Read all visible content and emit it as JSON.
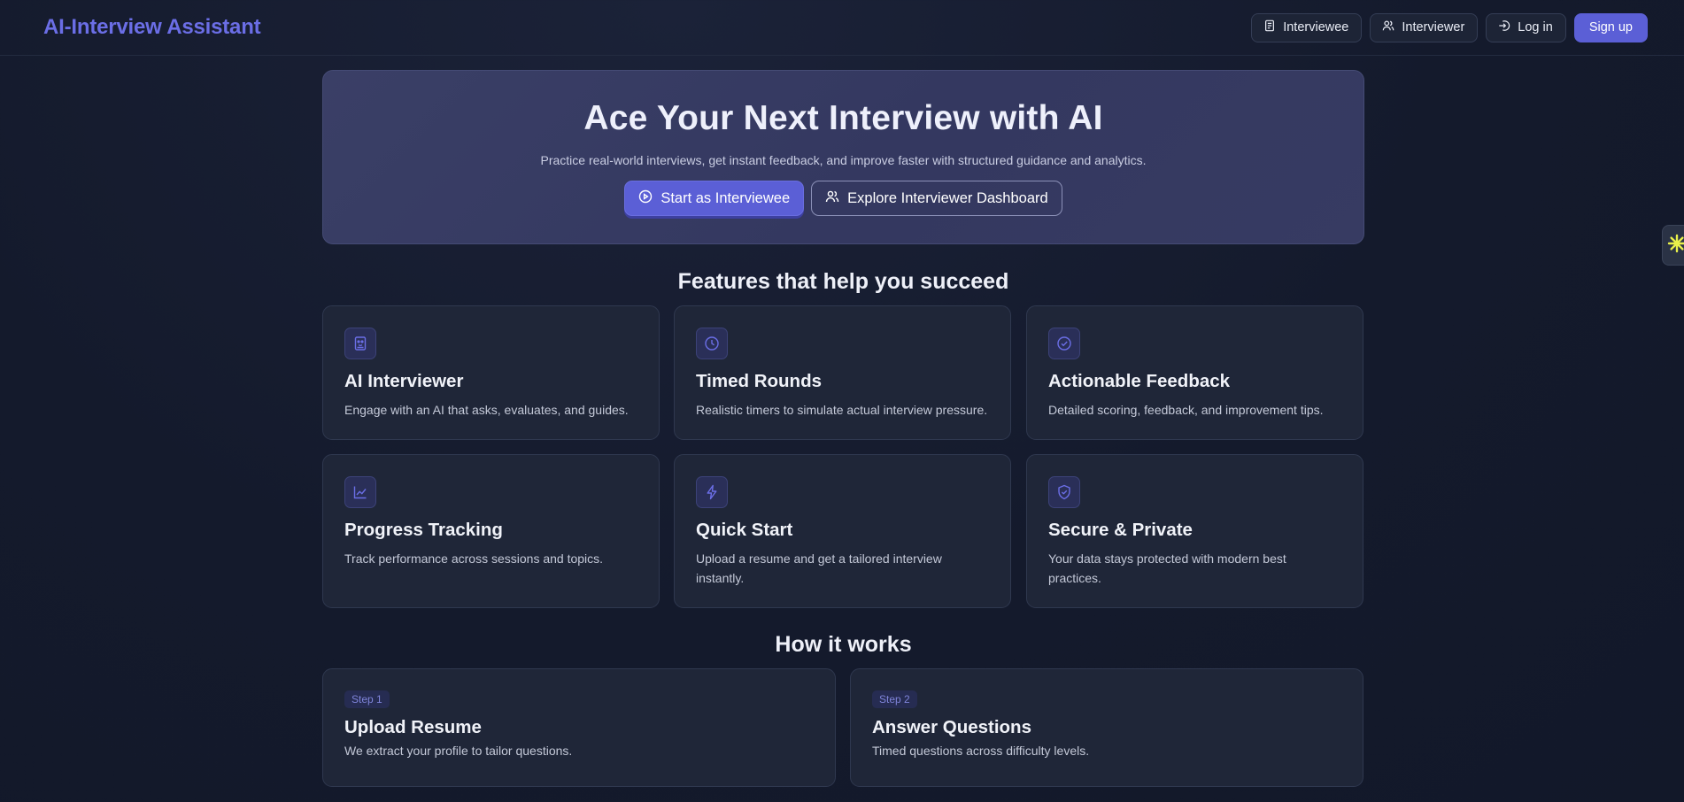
{
  "header": {
    "brand": "AI-Interview Assistant",
    "nav": {
      "interviewee": "Interviewee",
      "interviewer": "Interviewer",
      "login": "Log in",
      "signup": "Sign up"
    }
  },
  "hero": {
    "title": "Ace Your Next Interview with AI",
    "subtitle": "Practice real-world interviews, get instant feedback, and improve faster with structured guidance and analytics.",
    "primary_cta": "Start as Interviewee",
    "secondary_cta": "Explore Interviewer Dashboard"
  },
  "features": {
    "title": "Features that help you succeed",
    "items": [
      {
        "icon": "robot-icon",
        "title": "AI Interviewer",
        "desc": "Engage with an AI that asks, evaluates, and guides."
      },
      {
        "icon": "clock-icon",
        "title": "Timed Rounds",
        "desc": "Realistic timers to simulate actual interview pressure."
      },
      {
        "icon": "check-circle-icon",
        "title": "Actionable Feedback",
        "desc": "Detailed scoring, feedback, and improvement tips."
      },
      {
        "icon": "chart-line-icon",
        "title": "Progress Tracking",
        "desc": "Track performance across sessions and topics."
      },
      {
        "icon": "lightning-icon",
        "title": "Quick Start",
        "desc": "Upload a resume and get a tailored interview instantly."
      },
      {
        "icon": "shield-check-icon",
        "title": "Secure & Private",
        "desc": "Your data stays protected with modern best practices."
      }
    ]
  },
  "how_it_works": {
    "title": "How it works",
    "steps": [
      {
        "badge": "Step 1",
        "title": "Upload Resume",
        "desc": "We extract your profile to tailor questions."
      },
      {
        "badge": "Step 2",
        "title": "Answer Questions",
        "desc": "Timed questions across difficulty levels."
      }
    ]
  },
  "colors": {
    "accent": "#5b5fd6",
    "brand_text": "#6b6ee6",
    "background": "#141a2c",
    "card": "#1f2638"
  }
}
